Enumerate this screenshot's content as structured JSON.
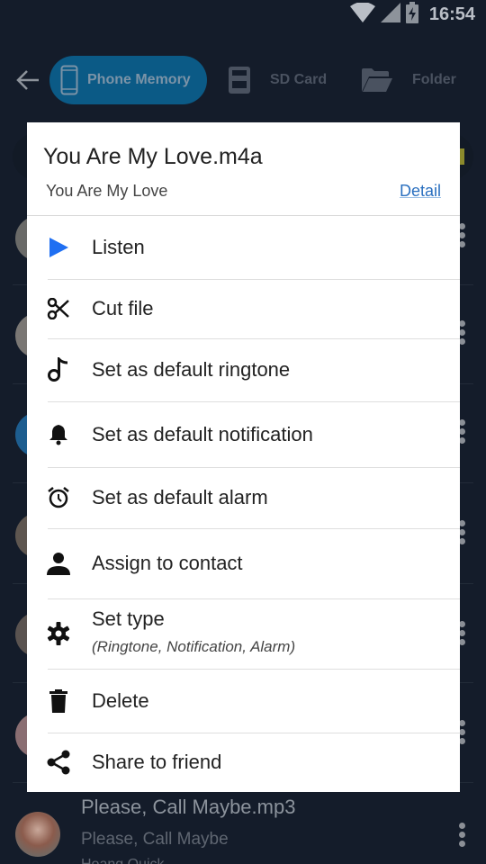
{
  "status_bar": {
    "time": "16:54",
    "icons": [
      "wifi-icon",
      "cellular-signal-icon",
      "battery-charging-icon"
    ]
  },
  "app_bar": {
    "back_icon": "arrow-left-icon",
    "tabs": [
      {
        "label": "Phone Memory",
        "icon": "smartphone-icon",
        "active": true
      },
      {
        "label": "SD Card",
        "icon": "sd-card-icon",
        "active": false
      },
      {
        "label": "Folder",
        "icon": "folder-open-icon",
        "active": false
      }
    ]
  },
  "background_list": {
    "visible_item": {
      "title": "Please, Call Maybe.mp3",
      "subtitle": "Please, Call Maybe",
      "third_line": "Hoang Quick"
    }
  },
  "dialog": {
    "title": "You Are My Love.m4a",
    "subtitle": "You Are My Love",
    "detail_link": "Detail",
    "accent_color": "#2a6fbf",
    "items": [
      {
        "label": "Listen",
        "icon": "play-icon",
        "icon_color": "#1f6ff2"
      },
      {
        "label": "Cut file",
        "icon": "scissors-icon"
      },
      {
        "label": "Set as default ringtone",
        "icon": "music-note-icon"
      },
      {
        "label": "Set as default notification",
        "icon": "bell-icon"
      },
      {
        "label": "Set as default alarm",
        "icon": "alarm-clock-icon"
      },
      {
        "label": "Assign to contact",
        "icon": "person-icon"
      },
      {
        "label": "Set type",
        "sublabel": "(Ringtone, Notification, Alarm)",
        "icon": "gear-icon"
      },
      {
        "label": "Delete",
        "icon": "trash-icon"
      },
      {
        "label": "Share to friend",
        "icon": "share-icon"
      }
    ]
  }
}
